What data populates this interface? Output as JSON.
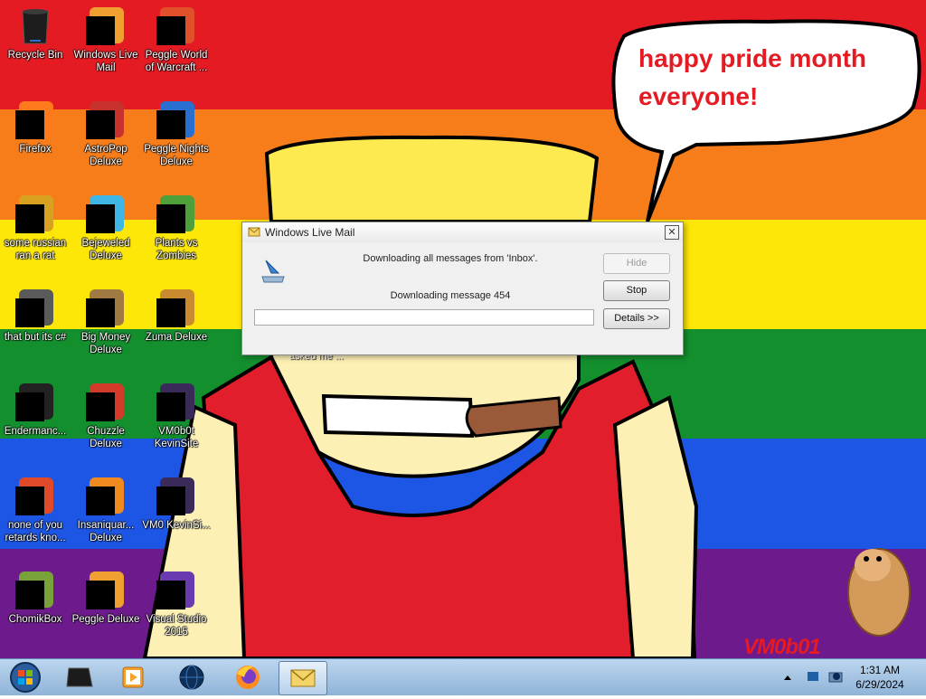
{
  "wallpaper": {
    "stripe_colors": [
      "#e41b23",
      "#f67d1a",
      "#fde708",
      "#138f2e",
      "#1d55e5",
      "#6d1b8c"
    ],
    "speech_bubble_lines": [
      "happy pride month",
      "everyone!"
    ],
    "signature": "VM0b01",
    "hidden_icon_label_fragment": "asked me ..."
  },
  "desktop_icons": [
    {
      "label": "Recycle Bin",
      "icon": "recycle-bin-icon",
      "redacted": false
    },
    {
      "label": "Windows Live Mail",
      "icon": "windows-live-mail-icon",
      "redacted": true
    },
    {
      "label": "Peggle World of Warcraft ...",
      "icon": "peggle-wow-icon",
      "redacted": true
    },
    {
      "label": "Firefox",
      "icon": "firefox-icon",
      "redacted": true
    },
    {
      "label": "AstroPop Deluxe",
      "icon": "astropop-icon",
      "redacted": true
    },
    {
      "label": "Peggle Nights Deluxe",
      "icon": "peggle-nights-icon",
      "redacted": true
    },
    {
      "label": "some russian ran a rat",
      "icon": "document-icon",
      "redacted": true
    },
    {
      "label": "Bejeweled Deluxe",
      "icon": "bejeweled-icon",
      "redacted": true
    },
    {
      "label": "Plants vs Zombies",
      "icon": "plants-vs-zombies-icon",
      "redacted": true
    },
    {
      "label": "that but its c#",
      "icon": "folder-stack-icon",
      "redacted": true
    },
    {
      "label": "Big Money Deluxe",
      "icon": "big-money-icon",
      "redacted": true
    },
    {
      "label": "Zuma Deluxe",
      "icon": "zuma-icon",
      "redacted": true
    },
    {
      "label": "Endermanc...",
      "icon": "terminal-icon",
      "redacted": true
    },
    {
      "label": "Chuzzle Deluxe",
      "icon": "chuzzle-icon",
      "redacted": true
    },
    {
      "label": "VM0b0t KevinSite",
      "icon": "kevinsite-icon",
      "redacted": true
    },
    {
      "label": "none of you retards kno...",
      "icon": "browser-icon",
      "redacted": true
    },
    {
      "label": "Insaniquar... Deluxe",
      "icon": "insaniquarium-icon",
      "redacted": true
    },
    {
      "label": "VM0 KevinSi...",
      "icon": "kevinsite-icon",
      "redacted": true
    },
    {
      "label": "ChomikBox",
      "icon": "chomikbox-icon",
      "redacted": true
    },
    {
      "label": "Peggle Deluxe",
      "icon": "peggle-icon",
      "redacted": true
    },
    {
      "label": "Visual Studio 2015",
      "icon": "visual-studio-icon",
      "redacted": true
    }
  ],
  "dialog": {
    "title": "Windows Live Mail",
    "status_line": "Downloading all messages from 'Inbox'.",
    "message_line": "Downloading message 454",
    "buttons": {
      "hide": "Hide",
      "stop": "Stop",
      "details": "Details >>"
    },
    "close_symbol": "✕",
    "progress_fraction": 0.0
  },
  "taskbar": {
    "items": [
      "start-orb-icon",
      "terminal-taskbar-icon",
      "media-player-icon",
      "globe-browser-icon",
      "firefox-taskbar-icon",
      "windows-live-mail-taskbar-icon"
    ],
    "clock_time": "1:31 AM",
    "clock_date": "6/29/2024"
  }
}
